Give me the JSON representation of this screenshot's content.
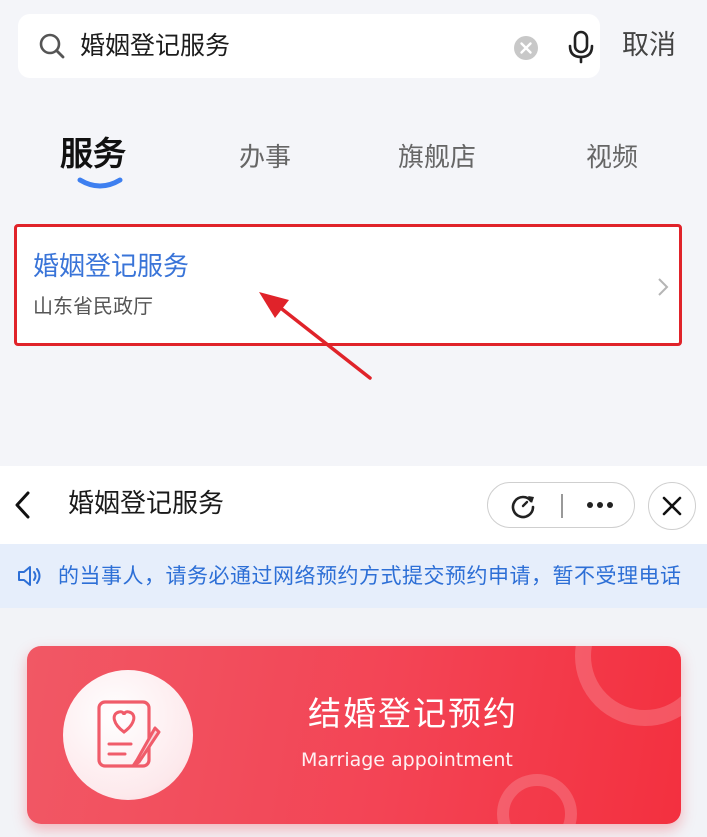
{
  "search": {
    "query": "婚姻登记服务",
    "cancel_label": "取消"
  },
  "tabs": [
    {
      "label": "服务",
      "active": true
    },
    {
      "label": "办事",
      "active": false
    },
    {
      "label": "旗舰店",
      "active": false
    },
    {
      "label": "视频",
      "active": false
    }
  ],
  "result": {
    "title": "婚姻登记服务",
    "subtitle": "山东省民政厅"
  },
  "miniapp": {
    "nav_title": "婚姻登记服务",
    "notice": "的当事人，请务必通过网络预约方式提交预约申请，暂不受理电话",
    "card": {
      "title": "结婚登记预约",
      "subtitle": "Marriage appointment"
    }
  },
  "colors": {
    "accent_blue": "#3974d8",
    "highlight_red": "#e0232a",
    "card_red": "#f34455",
    "notice_bg": "#e6eefb"
  },
  "icons": [
    "search-icon",
    "clear-icon",
    "microphone-icon",
    "chevron-right-icon",
    "back-icon",
    "refresh-icon",
    "more-icon",
    "close-icon",
    "speaker-icon",
    "heart-document-icon"
  ]
}
